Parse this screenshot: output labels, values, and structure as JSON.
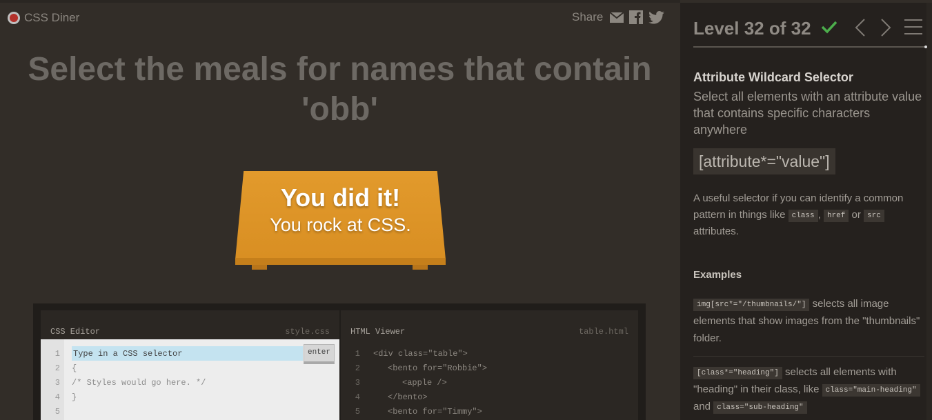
{
  "app": {
    "name": "CSS Diner"
  },
  "share": {
    "label": "Share",
    "icons": [
      "mail-icon",
      "facebook-icon",
      "twitter-icon"
    ]
  },
  "level": {
    "instruction": "Select the meals for names that contain 'obb'",
    "success_title": "You did it!",
    "success_sub": "You rock at CSS."
  },
  "editor": {
    "css_title": "CSS Editor",
    "css_file": "style.css",
    "placeholder": "Type in a CSS selector",
    "enter_label": "enter",
    "css_lines": [
      "{",
      "/* Styles would go here. */",
      "}"
    ],
    "html_title": "HTML Viewer",
    "html_file": "table.html",
    "html_lines": [
      "<div class=\"table\">",
      "<bento for=\"Robbie\">",
      "<apple />",
      "</bento>",
      "<bento for=\"Timmy\">"
    ],
    "line_numbers": [
      "1",
      "2",
      "3",
      "4",
      "5"
    ]
  },
  "sidebar": {
    "level_label": "Level 32 of 32",
    "completed": true,
    "colors": {
      "check": "#4cae4c"
    },
    "selector_name": "Attribute Wildcard Selector",
    "selector_desc": "Select all elements with an attribute value that contains specific characters anywhere",
    "syntax": "[attribute*=\"value\"]",
    "hint_pre": "A useful selector if you can identify a common pattern in things like",
    "hint_tags": [
      "class",
      "href",
      "src"
    ],
    "hint_mid": ",",
    "hint_or": "or",
    "hint_post": "attributes.",
    "examples_title": "Examples",
    "example1_code": "img[src*=\"/thumbnails/\"]",
    "example1_text": "selects all image elements that show images from the \"thumbnails\" folder.",
    "example2_code": "[class*=\"heading\"]",
    "example2_text": "selects all elements with \"heading\" in their class, like",
    "example2_tag1": "class=\"main-heading\"",
    "example2_and": "and",
    "example2_tag2": "class=\"sub-heading\""
  }
}
